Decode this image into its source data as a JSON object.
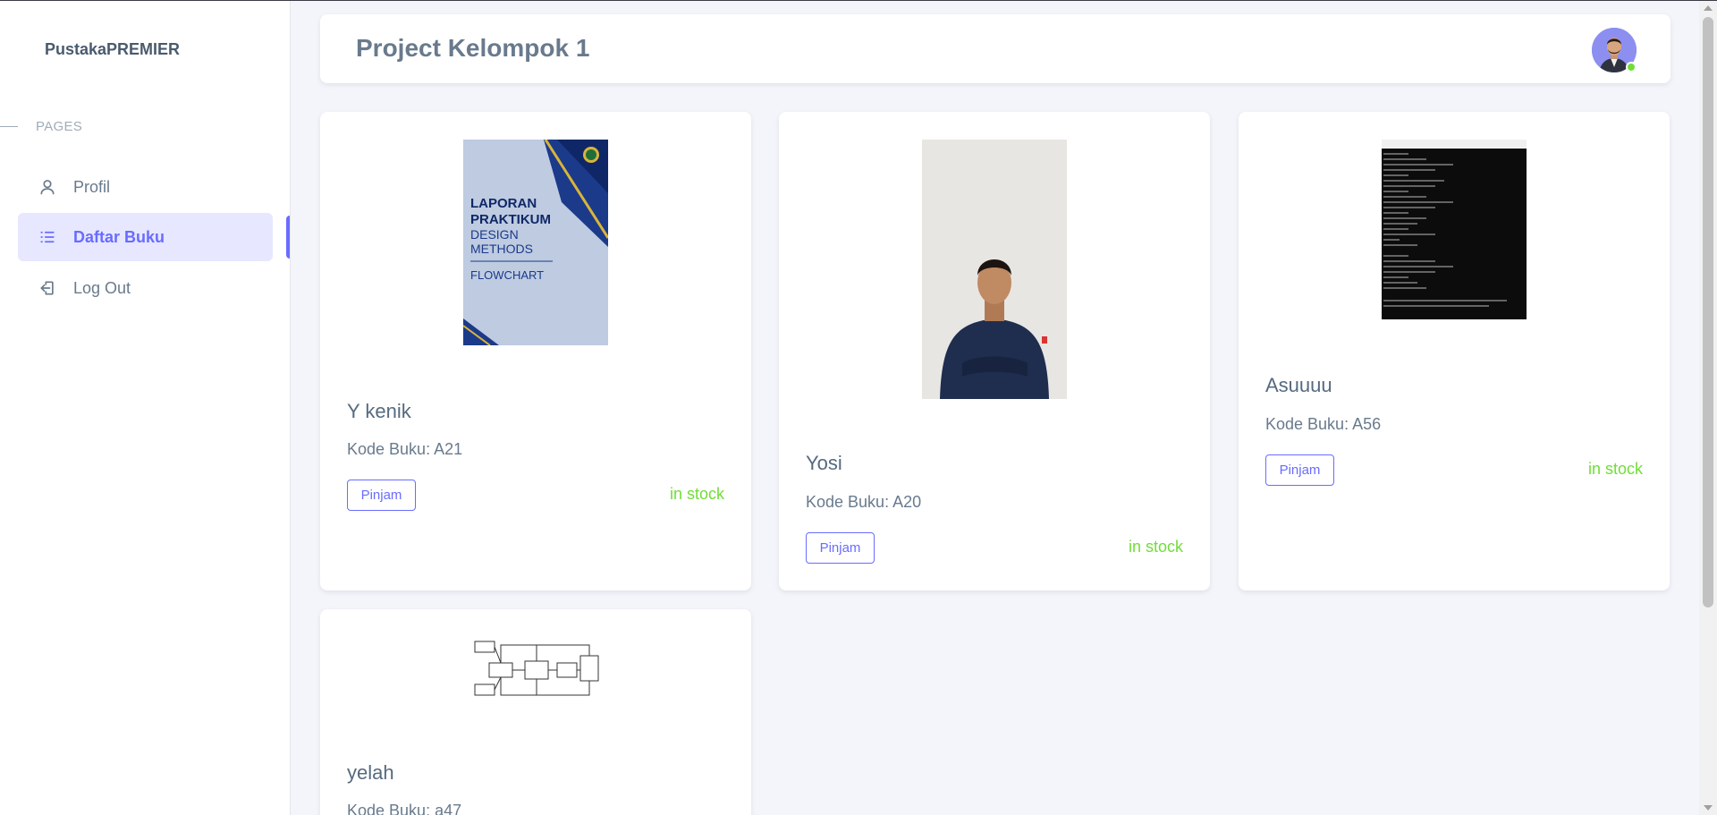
{
  "app": {
    "brand": "PustakaPREMIER"
  },
  "sidebar": {
    "section_label": "PAGES",
    "items": [
      {
        "label": "Profil",
        "icon": "user-icon",
        "active": false
      },
      {
        "label": "Daftar Buku",
        "icon": "list-icon",
        "active": true
      },
      {
        "label": "Log Out",
        "icon": "logout-icon",
        "active": false
      }
    ]
  },
  "header": {
    "title": "Project Kelompok 1",
    "avatar_status": "online"
  },
  "books": [
    {
      "title": "Y kenik",
      "code": "Kode Buku: A21",
      "button": "Pinjam",
      "stock": "in stock",
      "cover": {
        "line1": "LAPORAN",
        "line2": "PRAKTIKUM",
        "line3": "DESIGN",
        "line4": "METHODS",
        "line5": "FLOWCHART"
      }
    },
    {
      "title": "Yosi",
      "code": "Kode Buku: A20",
      "button": "Pinjam",
      "stock": "in stock"
    },
    {
      "title": "Asuuuu",
      "code": "Kode Buku: A56",
      "button": "Pinjam",
      "stock": "in stock"
    },
    {
      "title": "yelah",
      "code": "Kode Buku: a47"
    }
  ],
  "colors": {
    "accent": "#696cff",
    "accent_bg": "#e7e7ff",
    "stock_green": "#71dd37",
    "page_bg": "#f4f5fa",
    "text": "#566a7f"
  }
}
